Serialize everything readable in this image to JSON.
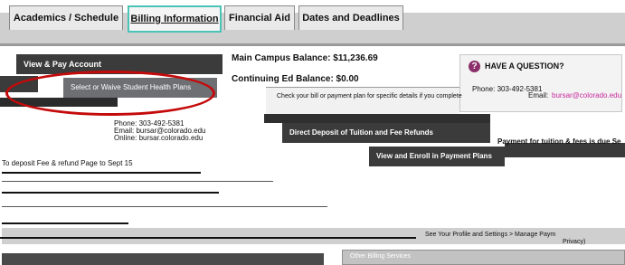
{
  "tabs": [
    {
      "label": "Academics / Schedule"
    },
    {
      "label": "Billing Information"
    },
    {
      "label": "Financial Aid"
    },
    {
      "label": "Dates and Deadlines"
    }
  ],
  "menu": {
    "view_pay_label": "View & Pay Account",
    "health_plans_label": "Select or Waive Student Health Plans",
    "direct_deposit_label": "Direct Deposit of Tuition and Fee Refunds",
    "payment_plans_label": "View and Enroll in Payment Plans",
    "other_services_label": "Other Billing Services"
  },
  "balances": {
    "main_campus": "Main Campus Balance: $11,236.69",
    "continuing": "Continuing Ed Balance: $0.00"
  },
  "question": {
    "heading": "HAVE A QUESTION?",
    "phone": "Phone: 303-492-5381",
    "email_prefix": "Email: ",
    "email": "bursar@colorado.edu"
  },
  "contact_left": {
    "phone": "Phone: 303-492-5381",
    "email": "Email: bursar@colorado.edu",
    "online": "Online: bursar.colorado.edu"
  },
  "notes": {
    "payment_plan": "Check your bill or payment plan for specific details if you complete",
    "tuition_due": "Payment for tuition & fees is due Se",
    "deposit": "To deposit Fee & refund Page to Sept 15",
    "profile": "See Your Profile and Settings > Manage Paym",
    "privacy": "Privacy)"
  },
  "colors": {
    "accent_tab_border": "#4cc3b7",
    "dark_box": "#3b3b3b",
    "highlight_oval": "#c40a0a",
    "question_icon": "#8b2f6b",
    "email_link": "#c8299b"
  }
}
